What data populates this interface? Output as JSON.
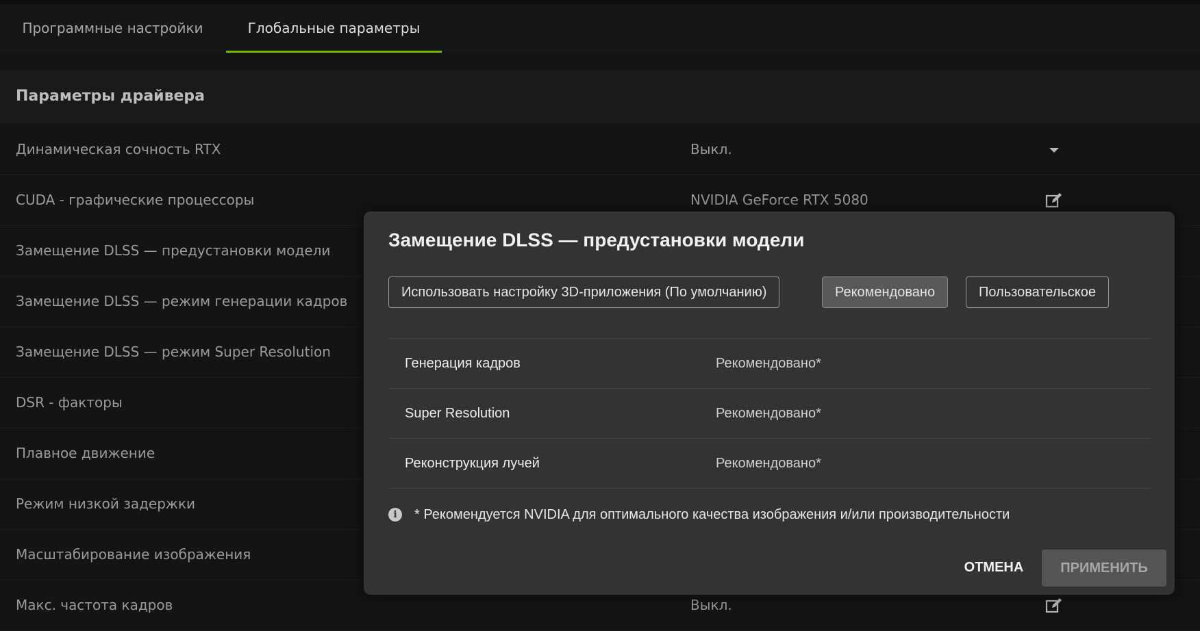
{
  "tabs": [
    {
      "label": "Программные настройки"
    },
    {
      "label": "Глобальные параметры"
    }
  ],
  "section": {
    "title": "Параметры драйвера"
  },
  "settings": [
    {
      "label": "Динамическая сочность RTX",
      "value": "Выкл.",
      "control": "chevron-down-icon"
    },
    {
      "label": "CUDA - графические процессоры",
      "value": "NVIDIA GeForce RTX 5080",
      "control": "edit-icon"
    },
    {
      "label": "Замещение DLSS — предустановки модели",
      "value": ""
    },
    {
      "label": "Замещение DLSS — режим генерации кадров",
      "value": ""
    },
    {
      "label": "Замещение DLSS — режим Super Resolution",
      "value": ""
    },
    {
      "label": "DSR - факторы",
      "value": ""
    },
    {
      "label": "Плавное движение",
      "value": ""
    },
    {
      "label": "Режим низкой задержки",
      "value": ""
    },
    {
      "label": "Масштабирование изображения",
      "value": ""
    },
    {
      "label": "Макс. частота кадров",
      "value": "Выкл.",
      "control": "edit-icon"
    }
  ],
  "modal": {
    "title": "Замещение DLSS — предустановки модели",
    "options": [
      {
        "label": "Использовать настройку 3D-приложения (По умолчанию)",
        "selected": false
      },
      {
        "label": "Рекомендовано",
        "selected": true
      },
      {
        "label": "Пользовательское",
        "selected": false
      }
    ],
    "rows": [
      {
        "label": "Генерация кадров",
        "value": "Рекомендовано*"
      },
      {
        "label": "Super Resolution",
        "value": "Рекомендовано*"
      },
      {
        "label": "Реконструкция лучей",
        "value": "Рекомендовано*"
      }
    ],
    "note": "* Рекомендуется NVIDIA для оптимального качества изображения и/или производительности",
    "info_icon_glyph": "i",
    "cancel_label": "ОТМЕНА",
    "apply_label": "ПРИМЕНИТЬ"
  },
  "colors": {
    "accent": "#76b900",
    "background": "#141414",
    "modal_background": "#333333"
  }
}
